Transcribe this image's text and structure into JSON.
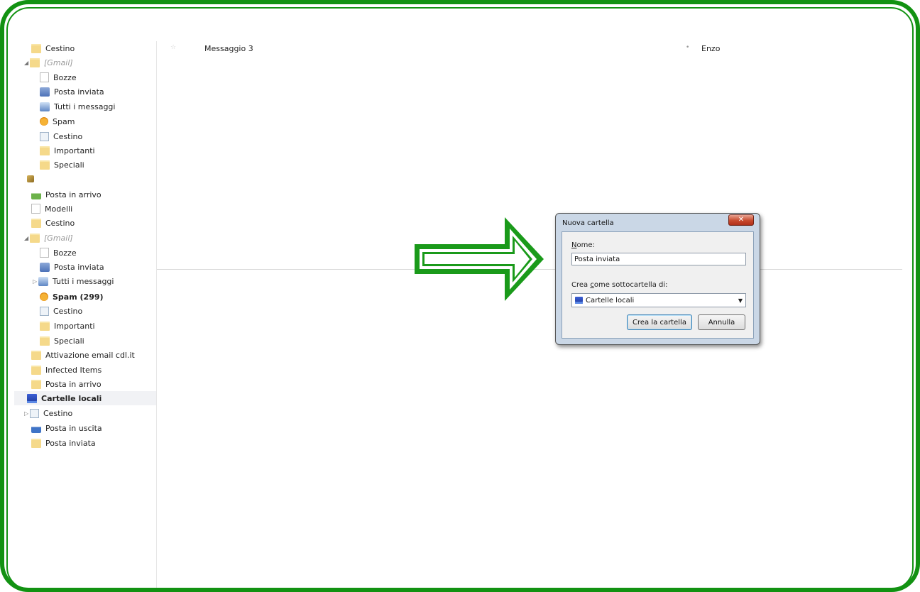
{
  "sidebar": {
    "items": [
      {
        "label": "Cestino",
        "icon": "folder-icon"
      },
      {
        "label": "[Gmail]",
        "icon": "folder-icon"
      },
      {
        "label": "Bozze",
        "icon": "drafts-icon"
      },
      {
        "label": "Posta inviata",
        "icon": "sent-icon"
      },
      {
        "label": "Tutti i messaggi",
        "icon": "all-mail-icon"
      },
      {
        "label": "Spam",
        "icon": "spam-icon"
      },
      {
        "label": "Cestino",
        "icon": "trash-icon"
      },
      {
        "label": "Importanti",
        "icon": "folder-icon"
      },
      {
        "label": "Speciali",
        "icon": "folder-icon"
      },
      {
        "label": "",
        "icon": "account-icon"
      },
      {
        "label": "Posta in arrivo",
        "icon": "inbox-icon"
      },
      {
        "label": "Modelli",
        "icon": "templates-icon"
      },
      {
        "label": "Cestino",
        "icon": "folder-icon"
      },
      {
        "label": "[Gmail]",
        "icon": "folder-icon"
      },
      {
        "label": "Bozze",
        "icon": "drafts-icon"
      },
      {
        "label": "Posta inviata",
        "icon": "sent-icon"
      },
      {
        "label": "Tutti i messaggi",
        "icon": "all-mail-icon"
      },
      {
        "label": "Spam (299)",
        "icon": "spam-icon"
      },
      {
        "label": "Cestino",
        "icon": "trash-icon"
      },
      {
        "label": "Importanti",
        "icon": "folder-icon"
      },
      {
        "label": "Speciali",
        "icon": "folder-icon"
      },
      {
        "label": "Attivazione email cdl.it",
        "icon": "folder-icon"
      },
      {
        "label": "Infected Items",
        "icon": "folder-icon"
      },
      {
        "label": "Posta in arrivo",
        "icon": "folder-icon"
      },
      {
        "label": "Cartelle locali",
        "icon": "local-folders-icon"
      },
      {
        "label": "Cestino",
        "icon": "trash-icon"
      },
      {
        "label": "Posta in uscita",
        "icon": "outbox-icon"
      },
      {
        "label": "Posta inviata",
        "icon": "folder-icon"
      }
    ]
  },
  "message_list": {
    "rows": [
      {
        "star": "☆",
        "subject": "Messaggio 3",
        "dot": "•",
        "from": "Enzo"
      }
    ]
  },
  "dialog": {
    "title": "Nuova cartella",
    "close_label": "✕",
    "name_label_accel": "N",
    "name_label_rest": "ome:",
    "name_value": "Posta inviata",
    "parent_label_pre": "Crea ",
    "parent_label_accel": "c",
    "parent_label_rest": "ome sottocartella di:",
    "parent_value": "Cartelle locali",
    "caret": "▼",
    "create_button": "Crea la cartella",
    "cancel_button": "Annulla"
  },
  "colors": {
    "frame": "#129212",
    "arrow": "#1a9a1a"
  }
}
